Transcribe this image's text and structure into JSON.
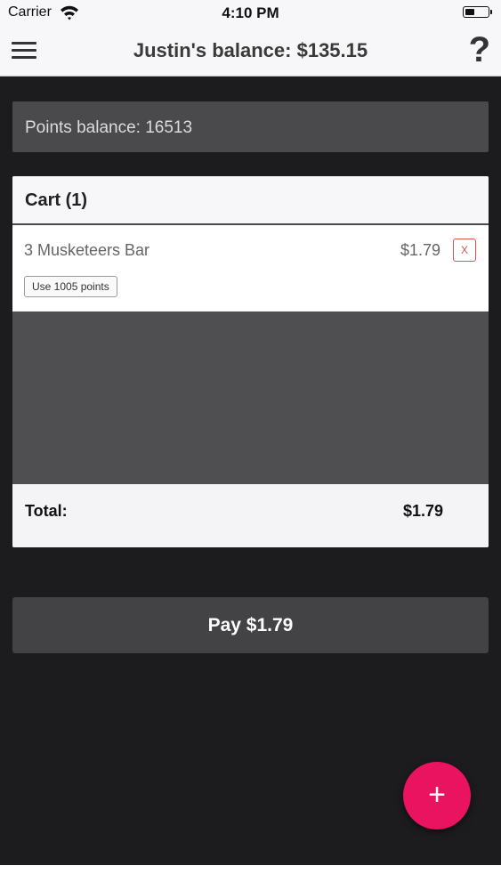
{
  "status_bar": {
    "carrier": "Carrier",
    "time": "4:10 PM",
    "battery_level": 0.4
  },
  "nav": {
    "title": "Justin's balance: $135.15",
    "help_symbol": "?",
    "menu_icon": "hamburger-menu-icon",
    "help_icon": "question-mark-icon"
  },
  "points": {
    "label": "Points balance: 16513"
  },
  "cart": {
    "title": "Cart (1)",
    "items": [
      {
        "name": "3 Musketeers Bar",
        "price": "$1.79",
        "remove_label": "X",
        "use_points_label": "Use 1005 points"
      }
    ],
    "total_label": "Total:",
    "total_value": "$1.79"
  },
  "pay": {
    "label": "Pay $1.79"
  },
  "fab": {
    "label": "+",
    "icon": "plus-icon",
    "color": "#e9135f"
  }
}
